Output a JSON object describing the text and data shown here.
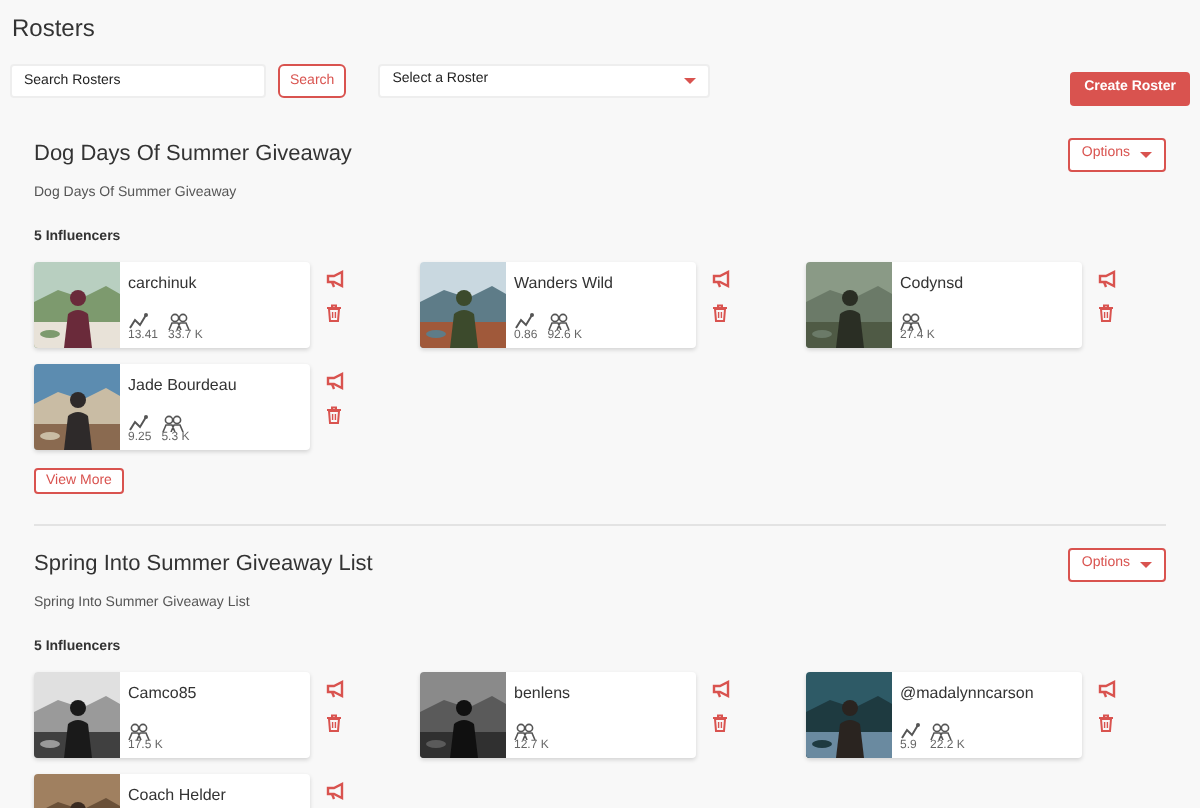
{
  "page": {
    "title": "Rosters"
  },
  "toolbar": {
    "search": {
      "placeholder": "Search Rosters"
    },
    "search_button": "Search",
    "select": {
      "value": "Select a Roster"
    },
    "create_button": "Create Roster"
  },
  "rosters": [
    {
      "title": "Dog Days Of Summer Giveaway",
      "subtitle": "Dog Days Of Summer Giveaway",
      "options_button": "Options",
      "count": "5 Influencers",
      "influencers": [
        {
          "name": "carchinuk",
          "engagement": "13.41",
          "followers": "33.7 K"
        },
        {
          "name": "Wanders Wild",
          "engagement": "0.86",
          "followers": "92.6 K"
        },
        {
          "name": "Codynsd",
          "followers": "27.4 K"
        },
        {
          "name": "Jade Bourdeau",
          "engagement": "9.25",
          "followers": "5.3 K"
        }
      ],
      "view_more": "View More"
    },
    {
      "title": "Spring Into Summer Giveaway List",
      "subtitle": "Spring Into Summer Giveaway List",
      "options_button": "Options",
      "count": "5 Influencers",
      "influencers": [
        {
          "name": "Camco85",
          "followers": "17.5 K"
        },
        {
          "name": "benlens",
          "followers": "12.7 K"
        },
        {
          "name": "@madalynncarson",
          "engagement": "5.9",
          "followers": "22.2 K"
        },
        {
          "name": "Coach Helder"
        }
      ]
    }
  ]
}
